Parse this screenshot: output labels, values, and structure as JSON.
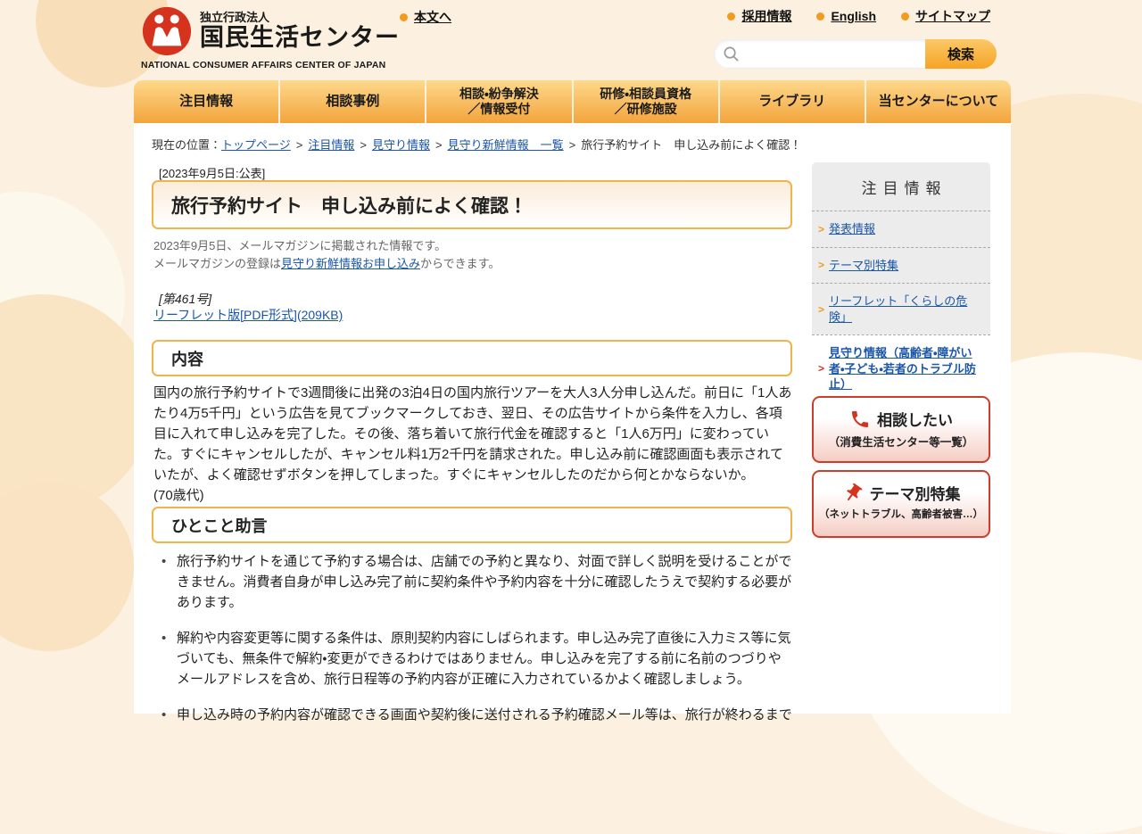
{
  "header": {
    "org_type": "独立行政法人",
    "org_name": "国民生活センター",
    "org_name_en": "NATIONAL CONSUMER AFFAIRS CENTER OF JAPAN",
    "skip_link": "本文へ",
    "top_links": [
      {
        "label": "採用情報"
      },
      {
        "label": "English"
      },
      {
        "label": "サイトマップ"
      }
    ],
    "search": {
      "placeholder": "",
      "button_label": "検索"
    }
  },
  "nav": {
    "items": [
      {
        "line1": "注目情報",
        "line2": ""
      },
      {
        "line1": "相談事例",
        "line2": ""
      },
      {
        "line1": "相談・紛争解決",
        "line2": "／情報受付"
      },
      {
        "line1": "研修・相談員資格",
        "line2": "／研修施設"
      },
      {
        "line1": "ライブラリ",
        "line2": ""
      },
      {
        "line1": "当センターについて",
        "line2": ""
      }
    ]
  },
  "breadcrumb": {
    "prefix": "現在の位置：",
    "separator": ">",
    "links": [
      {
        "label": "トップページ"
      },
      {
        "label": "注目情報"
      },
      {
        "label": "見守り情報"
      },
      {
        "label": "見守り新鮮情報　一覧"
      }
    ],
    "current": "旅行予約サイト　申し込み前によく確認！"
  },
  "article": {
    "published": "[2023年9月5日:公表]",
    "title": "旅行予約サイト　申し込み前によく確認！",
    "note_line1": "2023年9月5日、メールマガジンに掲載された情報です。",
    "note_line2_pre": "メールマガジンの登録は",
    "note_line2_link": "見守り新鮮情報お申し込み",
    "note_line2_post": "からできます。",
    "issue_label": "[第461号]",
    "pdf_link_label": "リーフレット版[PDF形式](209KB)",
    "content_heading": "内容",
    "content_text": "国内の旅行予約サイトで3週間後に出発の3泊4日の国内旅行ツアーを大人3人分申し込んだ。前日に「1人あたり4万5千円」という広告を見てブックマークしておき、翌日、その広告サイトから条件を入力し、各項目に入れて申し込みを完了した。その後、落ち着いて旅行代金を確認すると「1人6万円」に変わっていた。すぐにキャンセルしたが、キャンセル料1万2千円を請求された。申し込み前に確認画面も表示されていたが、よく確認せずボタンを押してしまった。すぐにキャンセルしたのだから何とかならないか。",
    "content_age": "(70歳代)",
    "advice_heading": "ひとこと助言",
    "advice_items": [
      {
        "text": "旅行予約サイトを通じて予約する場合は、店舗での予約と異なり、対面で詳しく説明を受けることができません。消費者自身が申し込み完了前に契約条件や予約内容を十分に確認したうえで契約する必要があります。"
      },
      {
        "text": "解約や内容変更等に関する条件は、原則契約内容にしばられます。申し込み完了直後に入力ミス等に気づいても、無条件で解約・変更ができるわけではありません。申し込みを完了する前に名前のつづりやメールアドレスを含め、旅行日程等の予約内容が正確に入力されているかよく確認しましょう。"
      },
      {
        "text": "申し込み時の予約内容が確認できる画面や契約後に送付される予約確認メール等は、旅行が終わるまで"
      }
    ]
  },
  "sidebar": {
    "heading": "注目情報",
    "arrow_glyph": ">",
    "items": [
      {
        "label": "発表情報"
      },
      {
        "label": "テーマ別特集"
      },
      {
        "label": "リーフレット「くらしの危険」"
      },
      {
        "label": "見守り情報（高齢者・障がい者・子ども・若者のトラブル防止）"
      }
    ],
    "contact_box": {
      "title": "相談したい",
      "subtitle": "（消費生活センター等一覧）"
    },
    "theme_box": {
      "title": "テーマ別特集",
      "subtitle": "（ネットトラブル、高齢者被害…）"
    }
  },
  "colors": {
    "background_cream": "#fcf1e0",
    "nav_orange_top": "#fdd98c",
    "nav_orange_bottom": "#f3a43c",
    "box_border_orange": "#f0b44d",
    "link_blue": "#1b56a8",
    "accent_red": "#d6331f",
    "bullet_orange": "#f39b1e"
  }
}
